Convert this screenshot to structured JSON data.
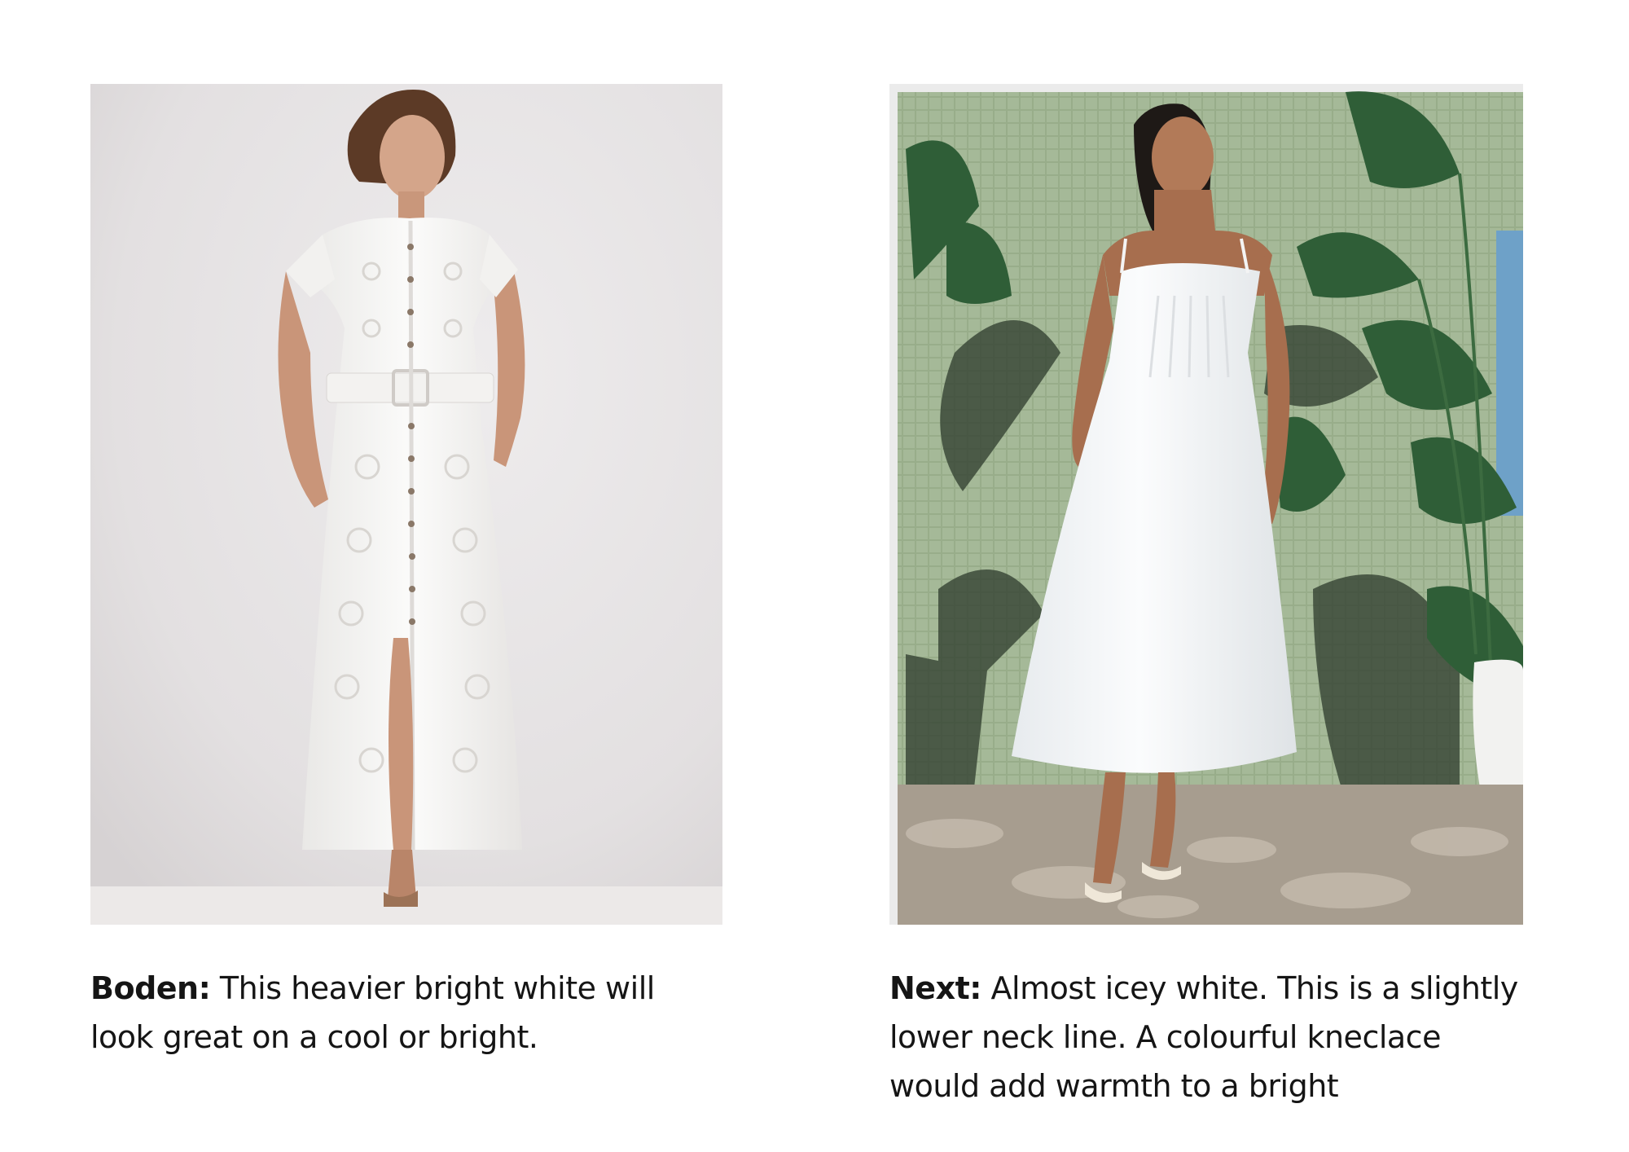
{
  "products": [
    {
      "brand": "Boden:",
      "description": "This heavier bright white will look great on a cool or bright."
    },
    {
      "brand": "Next:",
      "description": "Almost icey white. This is a slightly lower neck line. A colourful kneclace would add warmth to a bright"
    }
  ]
}
